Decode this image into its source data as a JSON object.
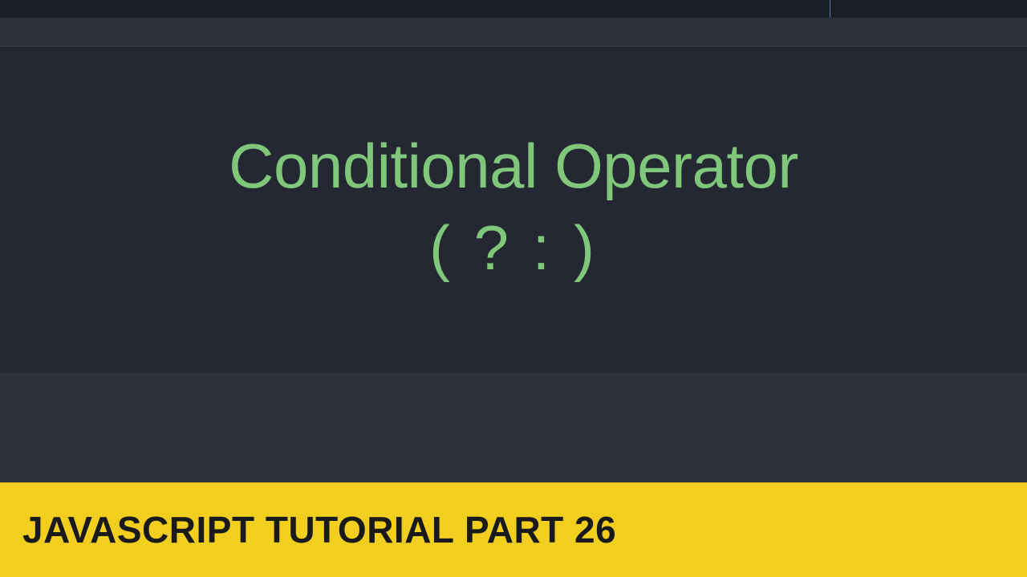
{
  "main": {
    "heading_line1": "Conditional Operator",
    "heading_line2": "( ? : )"
  },
  "footer": {
    "title": "JAVASCRIPT TUTORIAL PART 26"
  },
  "colors": {
    "text_green": "#80c77b",
    "banner_yellow": "#f2ce1f",
    "bg_dark": "#2b303b",
    "panel_dark": "#232832"
  }
}
